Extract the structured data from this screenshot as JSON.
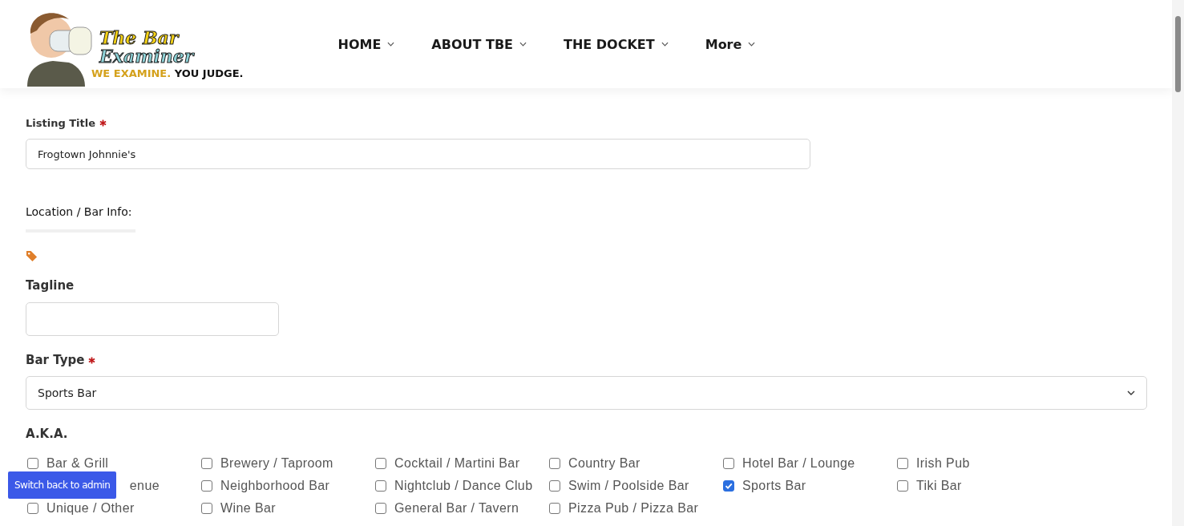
{
  "header": {
    "logo": {
      "title_top": "The Bar",
      "title_bottom": "Examiner",
      "slogan_accent": "WE EXAMINE.",
      "slogan": "YOU JUDGE."
    },
    "nav": [
      {
        "label": "HOME"
      },
      {
        "label": "ABOUT TBE"
      },
      {
        "label": "THE DOCKET"
      },
      {
        "label": "More"
      }
    ]
  },
  "form": {
    "listing_title": {
      "label": "Listing Title",
      "required": true,
      "value": "Frogtown Johnnie's"
    },
    "section": {
      "title": "Location / Bar Info:"
    },
    "tagline": {
      "label": "Tagline"
    },
    "bar_type": {
      "label": "Bar Type",
      "required": true,
      "value": "Sports Bar"
    },
    "aka": {
      "label": "A.K.A.",
      "options": [
        {
          "label": "Bar & Grill",
          "checked": false
        },
        {
          "label": "Brewery / Taproom",
          "checked": false
        },
        {
          "label": "Cocktail / Martini Bar",
          "checked": false
        },
        {
          "label": "Country Bar",
          "checked": false
        },
        {
          "label": "Hotel Bar / Lounge",
          "checked": false
        },
        {
          "label": "Irish Pub",
          "checked": false
        },
        {
          "label": "enue"
        },
        {
          "label": "Neighborhood Bar",
          "checked": false
        },
        {
          "label": "Nightclub / Dance Club",
          "checked": false
        },
        {
          "label": "Swim / Poolside Bar",
          "checked": false
        },
        {
          "label": "Sports Bar",
          "checked": true
        },
        {
          "label": "Tiki Bar",
          "checked": false
        },
        {
          "label": "Unique / Other",
          "checked": false
        },
        {
          "label": "Wine Bar",
          "checked": false
        },
        {
          "label": "General Bar / Tavern",
          "checked": false
        },
        {
          "label": "Pizza Pub / Pizza Bar",
          "checked": false
        }
      ]
    }
  },
  "admin_button": {
    "label": "Switch back to admin"
  }
}
